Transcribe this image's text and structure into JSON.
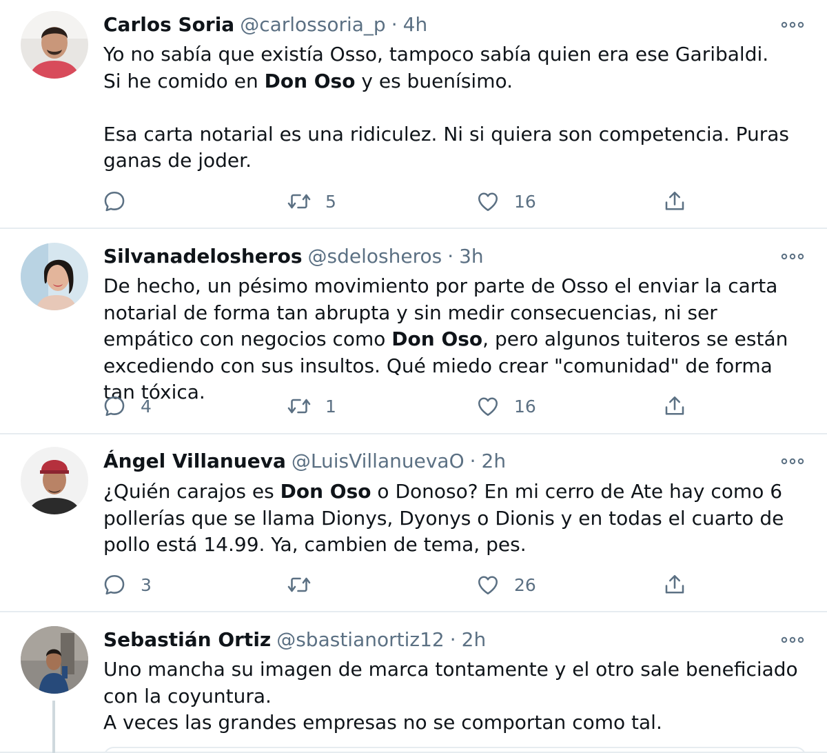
{
  "tweets": [
    {
      "name": "Carlos Soria",
      "handle": "@carlossoria_p",
      "separator": "·",
      "time": "4h",
      "text_parts": [
        {
          "t": "Yo no sabía que existía Osso, tampoco sabía quien era ese Garibaldi.\nSi he comido en ",
          "bold": false
        },
        {
          "t": "Don Oso",
          "bold": true
        },
        {
          "t": " y es buenísimo.\n\nEsa carta notarial es una ridiculez. Ni si quiera son competencia. Puras ganas de joder.",
          "bold": false
        }
      ],
      "replies": "",
      "retweets": "5",
      "likes": "16"
    },
    {
      "name": "Silvanadelosheros",
      "handle": "@sdelosheros",
      "separator": "·",
      "time": "3h",
      "text_parts": [
        {
          "t": "De hecho, un pésimo movimiento por parte de Osso el enviar la carta notarial de forma tan abrupta y sin medir consecuencias, ni ser empático con negocios como ",
          "bold": false
        },
        {
          "t": "Don Oso",
          "bold": true
        },
        {
          "t": ", pero algunos tuiteros se están excediendo con sus insultos. Qué miedo crear \"comunidad\" de forma tan tóxica.",
          "bold": false
        }
      ],
      "replies": "4",
      "retweets": "1",
      "likes": "16"
    },
    {
      "name": "Ángel Villanueva",
      "handle": "@LuisVillanuevaO",
      "separator": "·",
      "time": "2h",
      "text_parts": [
        {
          "t": "¿Quién carajos es ",
          "bold": false
        },
        {
          "t": "Don Oso",
          "bold": true
        },
        {
          "t": " o Donoso? En mi cerro de Ate hay como 6 pollerías que se llama Dionys, Dyonys o Dionis y en todas el cuarto de pollo está 14.99. Ya, cambien de tema, pes.",
          "bold": false
        }
      ],
      "replies": "3",
      "retweets": "",
      "likes": "26"
    },
    {
      "name": "Sebastián Ortiz",
      "handle": "@sbastianortiz12",
      "separator": "·",
      "time": "2h",
      "text_parts": [
        {
          "t": "Uno mancha su imagen de marca tontamente y el otro sale beneficiado con la coyuntura.\nA veces las grandes empresas no se comportan como tal.",
          "bold": false
        }
      ]
    }
  ],
  "icons": {
    "reply": "reply-icon",
    "retweet": "retweet-icon",
    "like": "heart-icon",
    "share": "share-icon",
    "more": "more-options-icon"
  },
  "colors": {
    "text": "#0f1419",
    "secondary": "#5b7083",
    "divider": "#e6ecf0"
  }
}
